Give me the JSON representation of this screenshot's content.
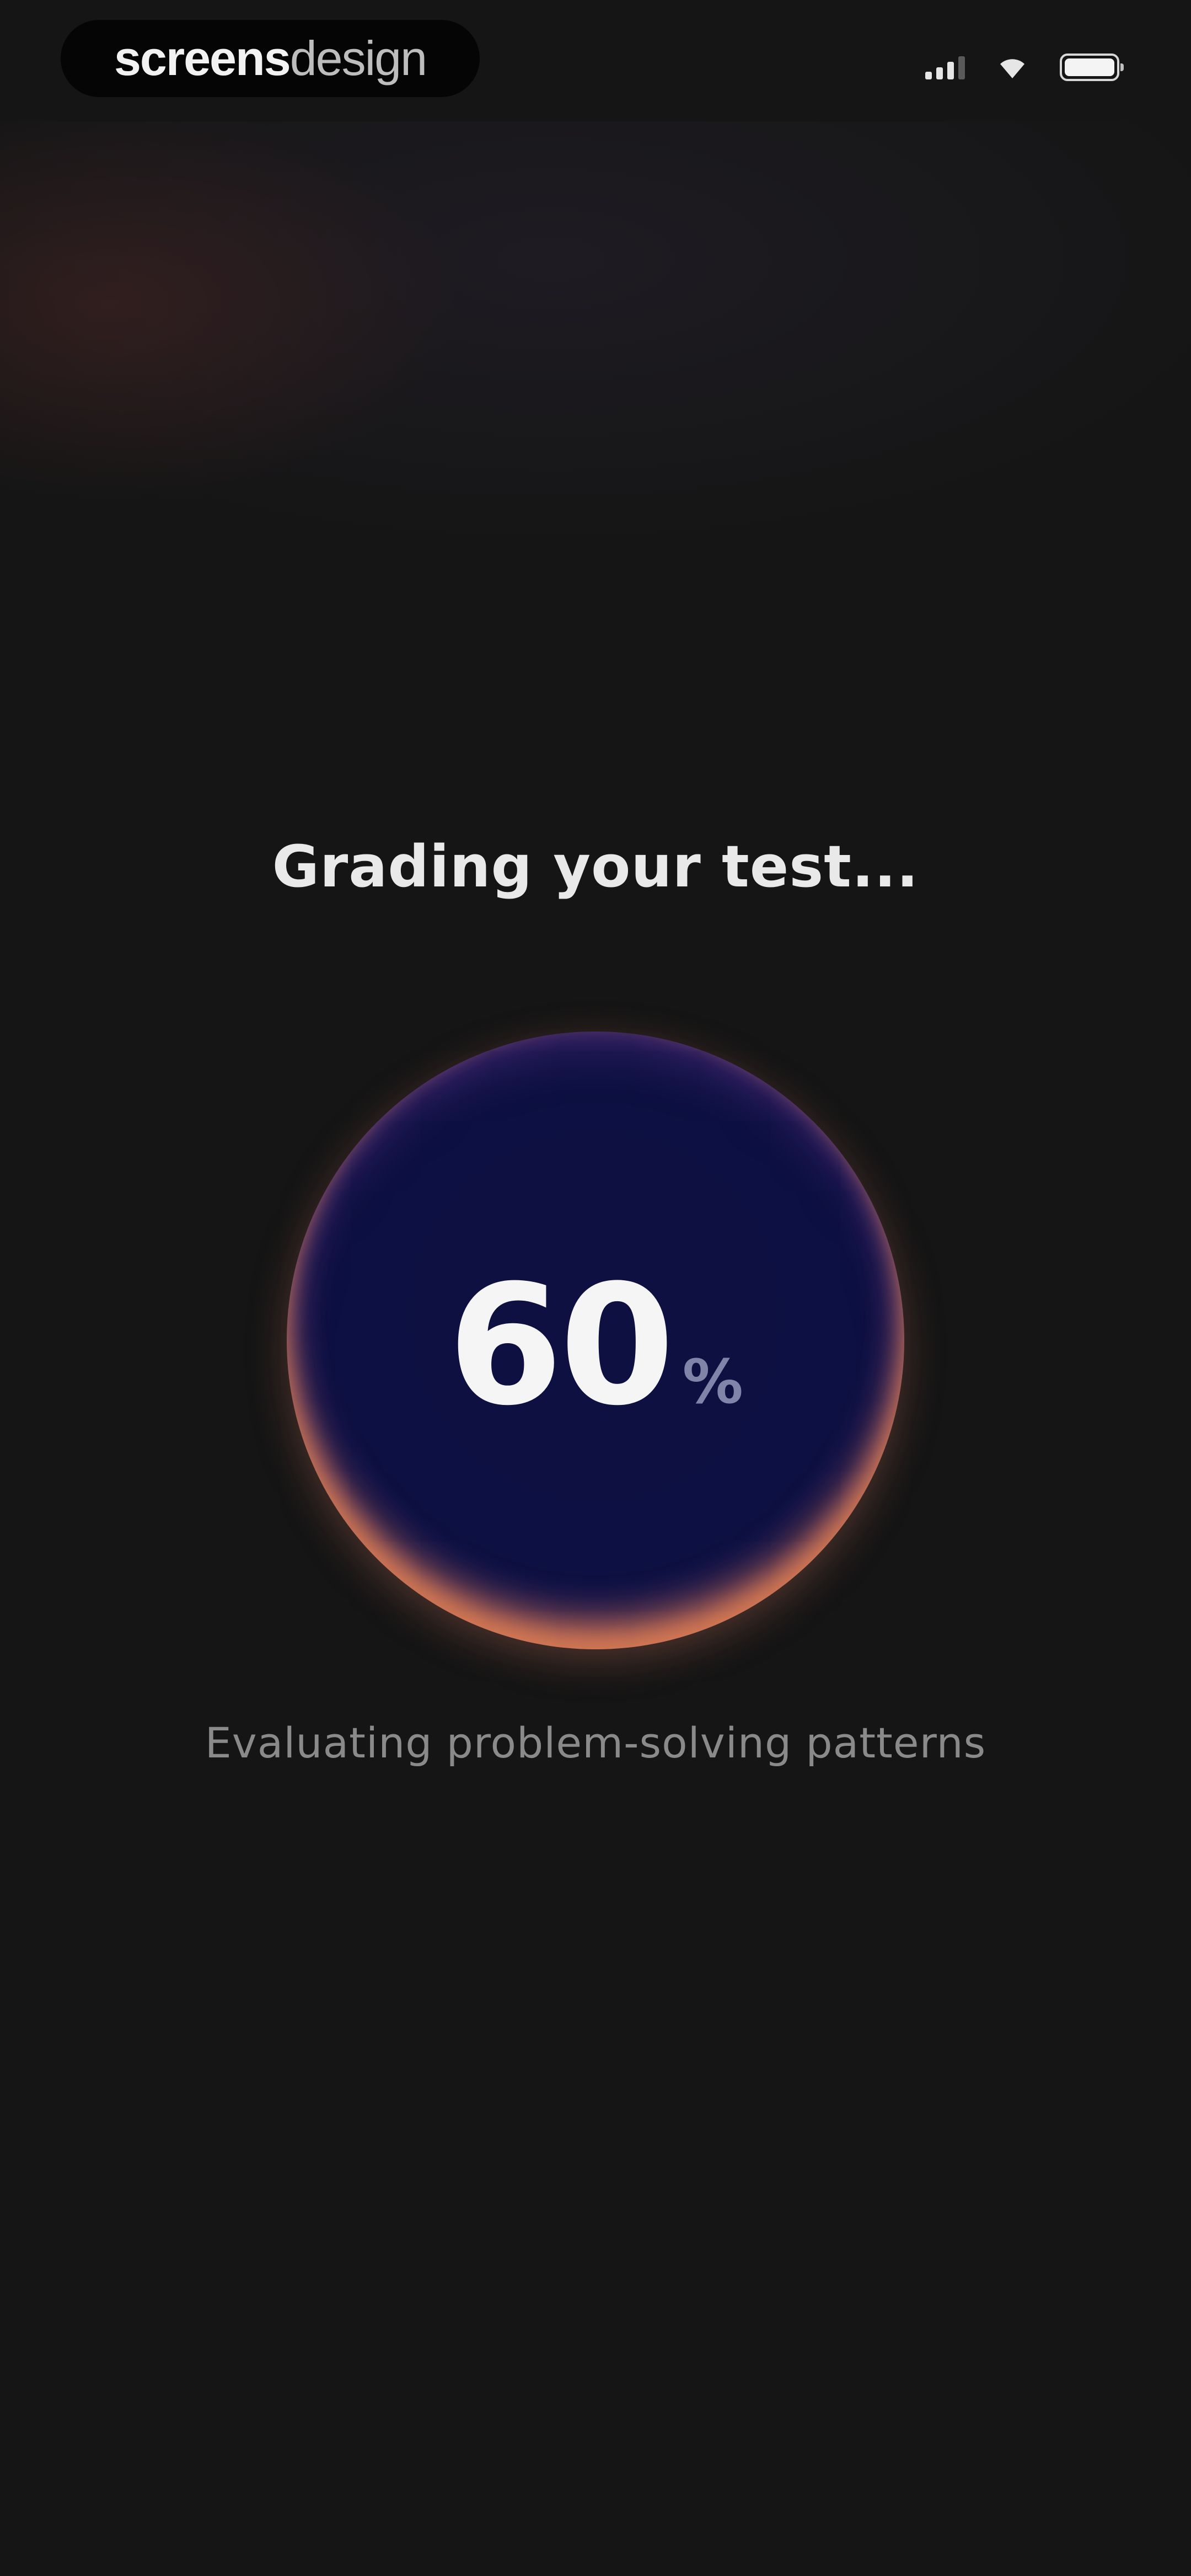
{
  "status_bar": {
    "brand_bold": "screens",
    "brand_light": "design",
    "icons": [
      "signal-icon",
      "wifi-icon",
      "battery-icon"
    ]
  },
  "main": {
    "title": "Grading your test...",
    "progress": {
      "value": "60",
      "unit": "%"
    },
    "subtitle": "Evaluating problem-solving patterns"
  },
  "colors": {
    "background": "#151515",
    "orb_core": "#0d1042",
    "orb_rim": "#e17d50",
    "text_primary": "#f5f5f5",
    "text_secondary": "#8a8a8a"
  }
}
